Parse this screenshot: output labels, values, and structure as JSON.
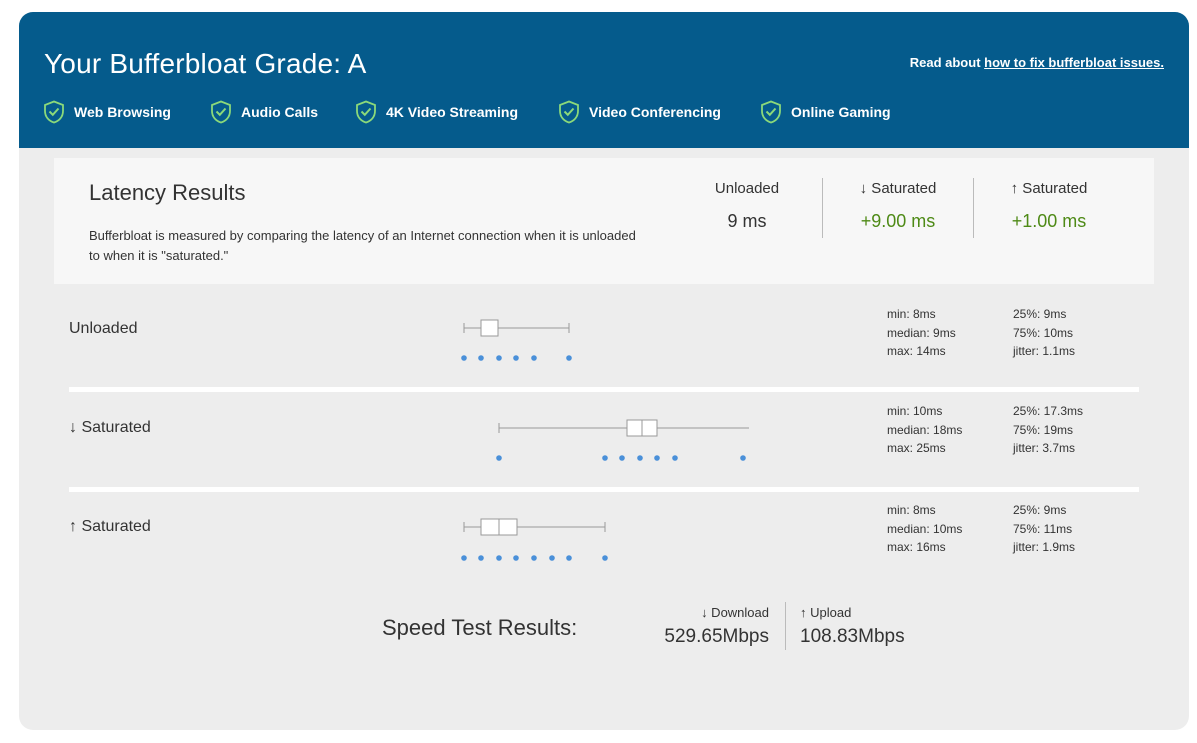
{
  "header": {
    "grade": "Your Bufferbloat Grade: A",
    "fix_prefix": "Read about ",
    "fix_link": "how to fix bufferbloat issues.",
    "badges": [
      "Web Browsing",
      "Audio Calls",
      "4K Video Streaming",
      "Video Conferencing",
      "Online Gaming"
    ],
    "badge_color": "#8bd97a"
  },
  "latency": {
    "title": "Latency Results",
    "description": "Bufferbloat is measured by comparing the latency of an Internet connection when it is unloaded to when it is \"saturated.\"",
    "unloaded": {
      "label": "Unloaded",
      "value": "9 ms"
    },
    "down": {
      "label": "↓ Saturated",
      "value": "+9.00 ms"
    },
    "up": {
      "label": "↑ Saturated",
      "value": "+1.00 ms"
    }
  },
  "rows": [
    {
      "name": "Unloaded",
      "min": "min: 8ms",
      "median": "median: 9ms",
      "max": "max: 14ms",
      "p25": "25%: 9ms",
      "p75": "75%: 10ms",
      "jitter": "jitter: 1.1ms"
    },
    {
      "name": "↓ Saturated",
      "min": "min: 10ms",
      "median": "median: 18ms",
      "max": "max: 25ms",
      "p25": "25%: 17.3ms",
      "p75": "75%: 19ms",
      "jitter": "jitter: 3.7ms"
    },
    {
      "name": "↑ Saturated",
      "min": "min: 8ms",
      "median": "median: 10ms",
      "max": "max: 16ms",
      "p25": "25%: 9ms",
      "p75": "75%: 11ms",
      "jitter": "jitter: 1.9ms"
    }
  ],
  "speed": {
    "title": "Speed Test Results:",
    "download_label": "↓ Download",
    "download_value": "529.65Mbps",
    "upload_label": "↑ Upload",
    "upload_value": "108.83Mbps"
  },
  "colors": {
    "header_bg": "#055b8c",
    "green": "#4e8a16",
    "dot": "#4a90d9"
  }
}
